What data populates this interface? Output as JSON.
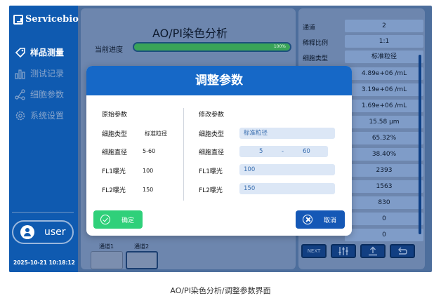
{
  "app": {
    "brand": "Servicebio",
    "clock": "2025-10-21 10:18:12",
    "user": "user"
  },
  "sidebar": {
    "items": [
      {
        "label": "样品测量",
        "icon": "tag-icon",
        "active": true
      },
      {
        "label": "测试记录",
        "icon": "bar-chart-icon",
        "active": false
      },
      {
        "label": "细胞参数",
        "icon": "share-icon",
        "active": false
      },
      {
        "label": "系统设置",
        "icon": "gear-icon",
        "active": false
      }
    ]
  },
  "main": {
    "title": "AO/PI染色分析",
    "progress_label": "当前进度",
    "progress_text": "100%",
    "progress": 1.0,
    "channels": [
      "通道1",
      "通道2"
    ]
  },
  "results": {
    "rows": [
      {
        "label": "通道",
        "value": "2"
      },
      {
        "label": "稀释比例",
        "value": "1:1"
      },
      {
        "label": "细胞类型",
        "value": "标准粒径"
      },
      {
        "label": "",
        "value": "4.89e+06 /mL"
      },
      {
        "label": "",
        "value": "3.19e+06 /mL"
      },
      {
        "label": "",
        "value": "1.69e+06 /mL"
      },
      {
        "label": "",
        "value": "15.58 μm"
      },
      {
        "label": "",
        "value": "65.32%"
      },
      {
        "label": "",
        "value": "38.40%"
      },
      {
        "label": "",
        "value": "2393"
      },
      {
        "label": "",
        "value": "1563"
      },
      {
        "label": "",
        "value": "830"
      },
      {
        "label": "",
        "value": "0"
      },
      {
        "label": "",
        "value": "0"
      }
    ],
    "tools": [
      "NEXT",
      "",
      "",
      ""
    ]
  },
  "dialog": {
    "title": "调整参数",
    "original": {
      "heading": "原始参数",
      "fields": [
        {
          "label": "细胞类型",
          "value": "标准粒径"
        },
        {
          "label": "细胞直径",
          "value": "5-60"
        },
        {
          "label": "FL1曝光",
          "value": "100"
        },
        {
          "label": "FL2曝光",
          "value": "150"
        }
      ]
    },
    "modified": {
      "heading": "修改参数",
      "cell_type_label": "细胞类型",
      "cell_type_value": "标准粒径",
      "diameter_label": "细胞直径",
      "diameter_min": "5",
      "diameter_sep": "-",
      "diameter_max": "60",
      "fl1_label": "FL1曝光",
      "fl1_value": "100",
      "fl2_label": "FL2曝光",
      "fl2_value": "150"
    },
    "confirm_label": "确定",
    "cancel_label": "取消"
  },
  "caption": "AO/PI染色分析/调整参数界面",
  "colors": {
    "sidebar": "#0f5ab0",
    "dialog_header": "#1668c7",
    "confirm": "#2fd07a",
    "cancel": "#1558b6",
    "progress": "#39a458"
  }
}
